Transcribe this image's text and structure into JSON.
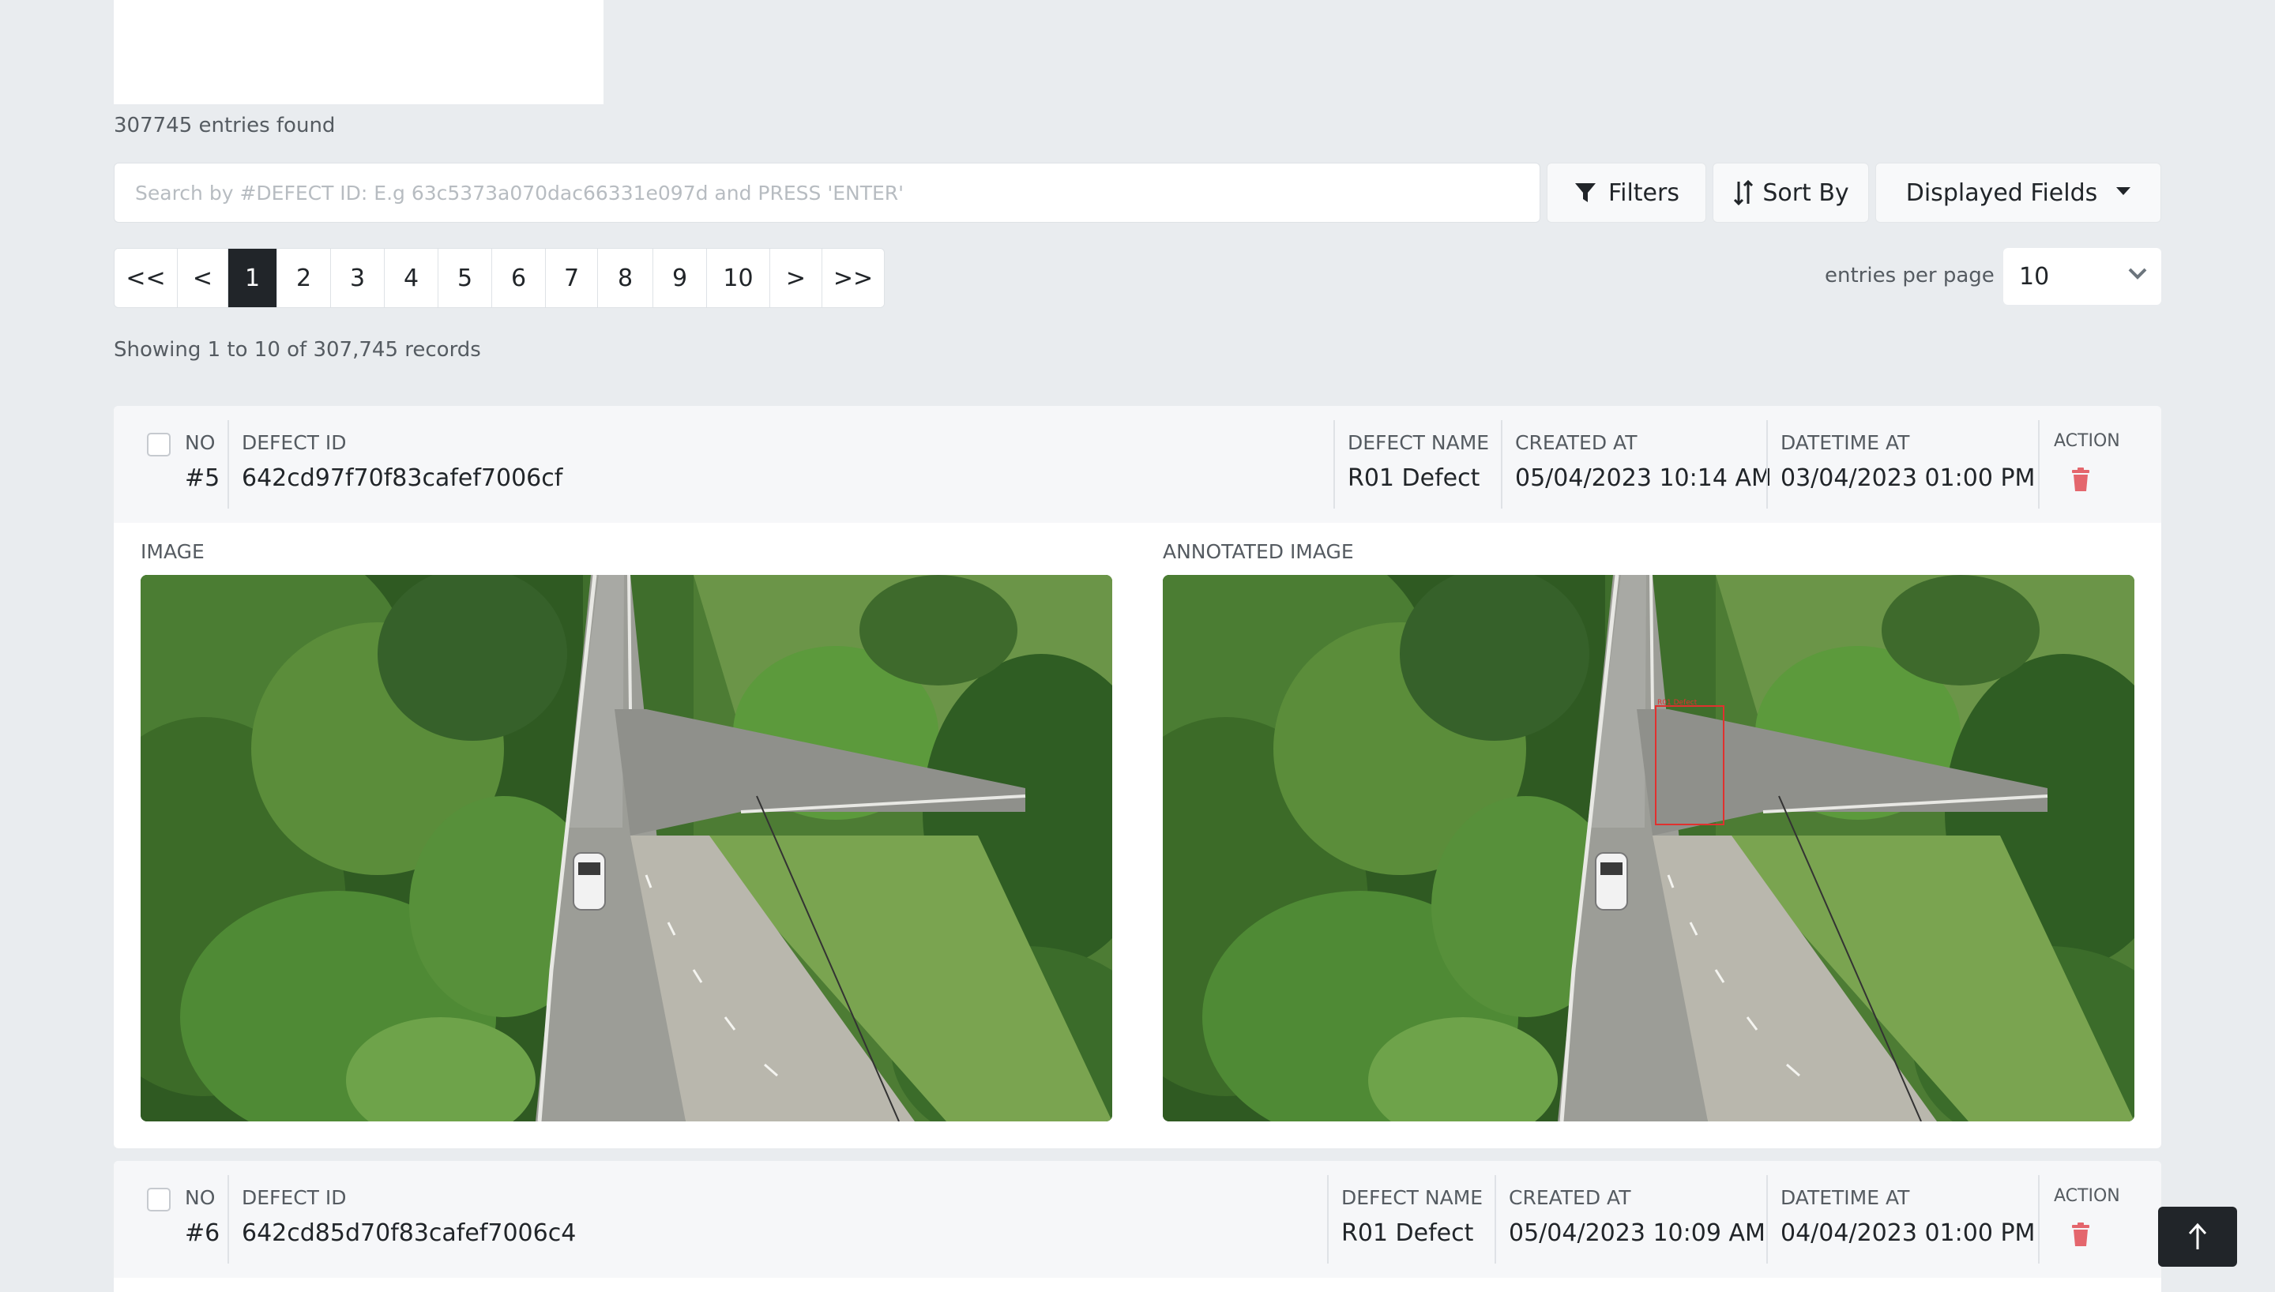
{
  "summary": {
    "entries_found": "307745 entries found",
    "showing": "Showing 1 to 10 of 307,745 records"
  },
  "search": {
    "placeholder": "Search by #DEFECT ID: E.g 63c5373a070dac66331e097d and PRESS 'ENTER'",
    "value": ""
  },
  "toolbar": {
    "filters_label": "Filters",
    "sort_label": "Sort By",
    "fields_label": "Displayed Fields"
  },
  "pagination": {
    "pages": [
      "<<",
      "<",
      "1",
      "2",
      "3",
      "4",
      "5",
      "6",
      "7",
      "8",
      "9",
      "10",
      ">",
      ">>"
    ],
    "active": "1",
    "entries_per_page_label": "entries per page",
    "entries_per_page_value": "10"
  },
  "columns": {
    "no": "NO",
    "defect_id": "DEFECT ID",
    "defect_name": "DEFECT NAME",
    "created_at": "CREATED AT",
    "datetime_at": "DATETIME AT",
    "action": "ACTION"
  },
  "records": [
    {
      "no": "#5",
      "defect_id": "642cd97f70f83cafef7006cf",
      "defect_name": "R01 Defect",
      "created_at": "05/04/2023 10:14 AM",
      "datetime_at": "03/04/2023 01:00 PM",
      "image_label": "IMAGE",
      "annotated_label": "ANNOTATED IMAGE",
      "annotation_text": "R01 Defect"
    },
    {
      "no": "#6",
      "defect_id": "642cd85d70f83cafef7006c4",
      "defect_name": "R01 Defect",
      "created_at": "05/04/2023 10:09 AM",
      "datetime_at": "04/04/2023 01:00 PM"
    }
  ],
  "colors": {
    "page_bg": "#e9ecef",
    "active_page": "#212529",
    "trash": "#e4666d",
    "annotation_box": "#e0312f"
  }
}
